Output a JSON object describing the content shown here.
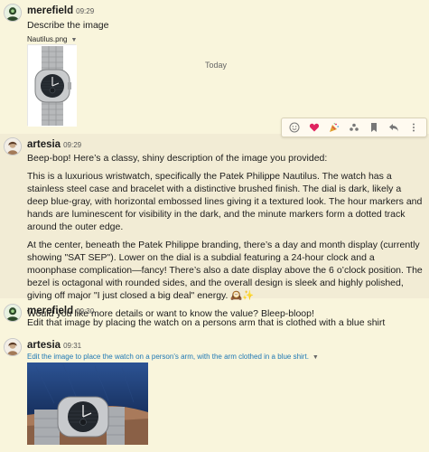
{
  "today_label": "Today",
  "posts": [
    {
      "author": "merefield",
      "time": "09:29",
      "text": "Describe the image",
      "attachment": "Nautilus.png"
    },
    {
      "author": "artesia",
      "time": "09:29",
      "paragraphs": [
        "Beep-bop! Here’s a classy, shiny description of the image you provided:",
        "This is a luxurious wristwatch, specifically the Patek Philippe Nautilus. The watch has a stainless steel case and bracelet with a distinctive brushed finish. The dial is dark, likely a deep blue-gray, with horizontal embossed lines giving it a textured look. The hour markers and hands are luminescent for visibility in the dark, and the minute markers form a dotted track around the outer edge.",
        "At the center, beneath the Patek Philippe branding, there’s a day and month display (currently showing \"SAT SEP\"). Lower on the dial is a subdial featuring a 24-hour clock and a moonphase complication—fancy! There’s also a date display above the 6 o’clock position. The bezel is octagonal with rounded sides, and the overall design is sleek and highly polished, giving off major \"I just closed a big deal\" energy. 🕰️✨",
        "Would you like more details or want to know the value? Bleep-bloop!"
      ]
    },
    {
      "author": "merefield",
      "time": "09:30",
      "text": "Edit that image by placing the watch on a persons arm that is clothed with a blue shirt"
    },
    {
      "author": "artesia",
      "time": "09:31",
      "attachment": "Edit the image to place the watch on a person's arm, with the arm clothed in a blue shirt."
    }
  ],
  "toolbar": {
    "items": [
      "emoji-reaction-icon",
      "heart-icon",
      "party-icon",
      "group-icon",
      "bookmark-icon",
      "reply-icon",
      "more-icon"
    ]
  },
  "colors": {
    "background": "#f9f5dc",
    "highlight": "#f2ecd5",
    "heart": "#e0245e",
    "link": "#1e78b4",
    "shirt": "#1f3f7a"
  }
}
